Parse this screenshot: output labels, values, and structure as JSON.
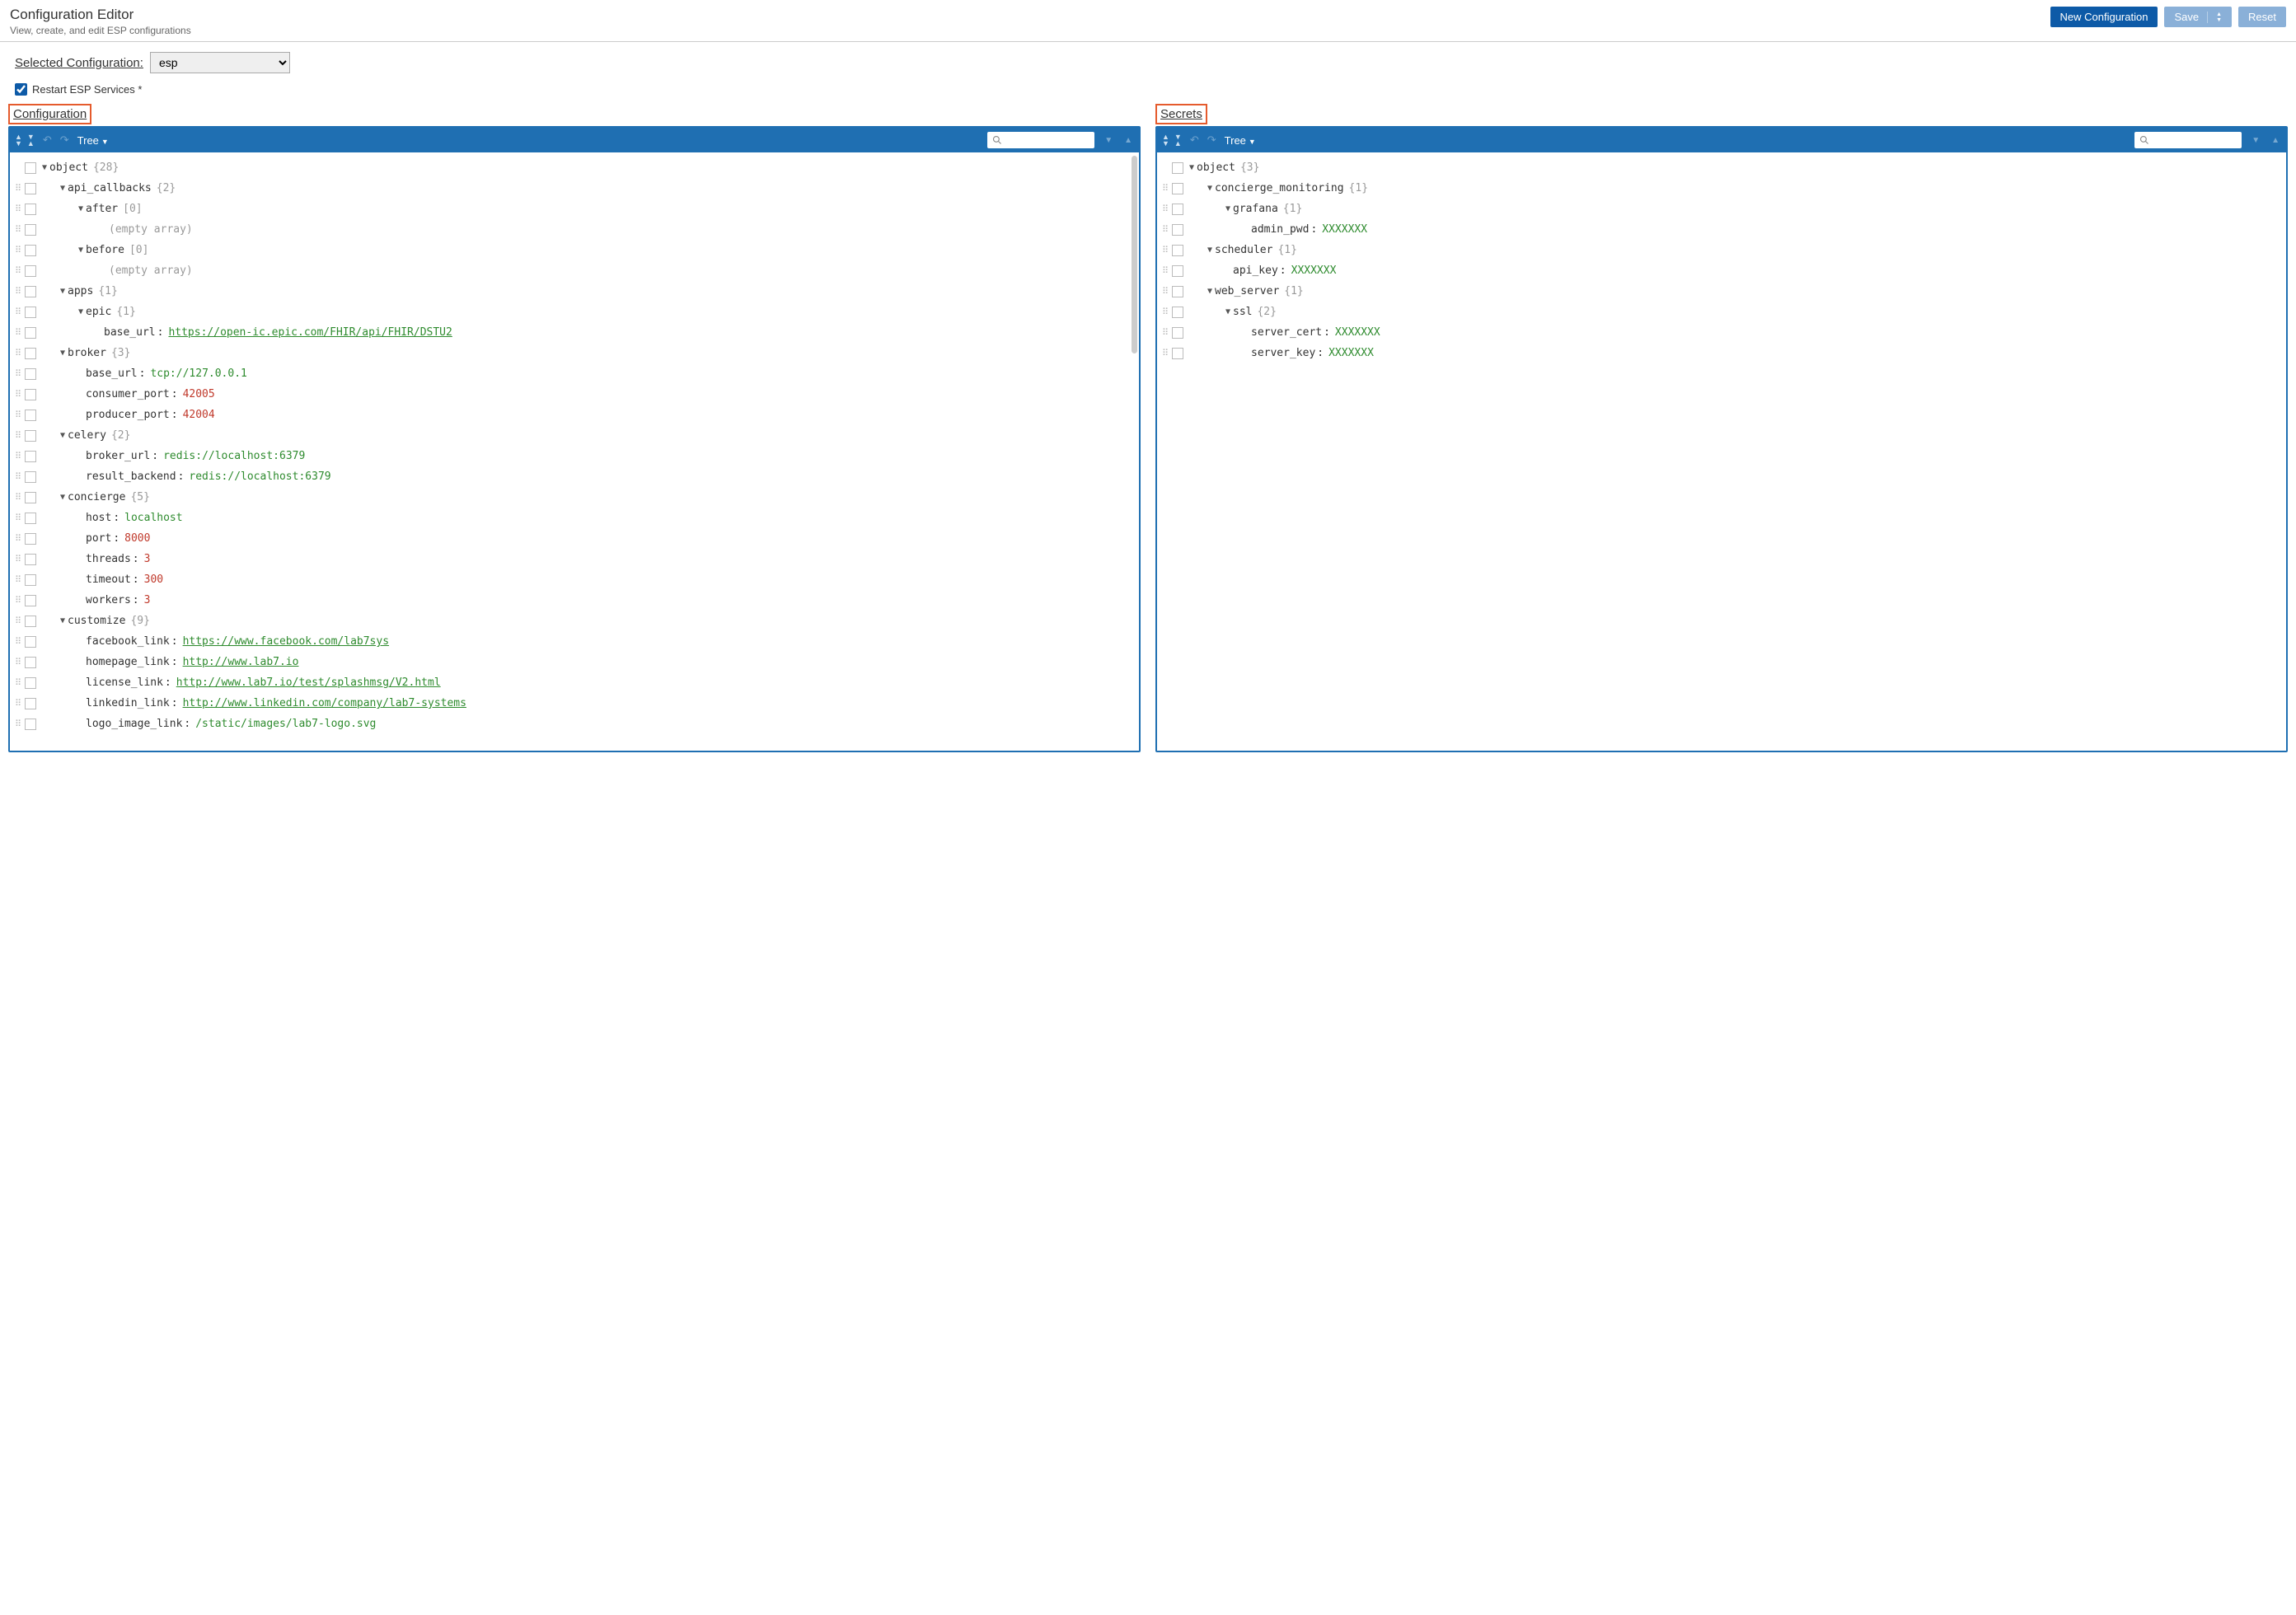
{
  "header": {
    "title": "Configuration Editor",
    "subtitle": "View, create, and edit ESP configurations",
    "buttons": {
      "new": "New Configuration",
      "save": "Save",
      "reset": "Reset"
    }
  },
  "selector": {
    "label": "Selected Configuration:",
    "value": "esp"
  },
  "restart": {
    "label": "Restart ESP Services *",
    "checked": true
  },
  "panels": {
    "config_title": "Configuration",
    "secrets_title": "Secrets"
  },
  "toolbar": {
    "mode": "Tree"
  },
  "config_tree": [
    {
      "indent": 0,
      "tw": "▼",
      "key": "object",
      "meta": "{28}",
      "handle": false
    },
    {
      "indent": 1,
      "tw": "▼",
      "key": "api_callbacks",
      "meta": "{2}"
    },
    {
      "indent": 2,
      "tw": "▼",
      "key": "after",
      "meta": "[0]"
    },
    {
      "indent": 3,
      "tw": "",
      "key": "",
      "literal": "(empty array)",
      "handleOnly": true
    },
    {
      "indent": 2,
      "tw": "▼",
      "key": "before",
      "meta": "[0]"
    },
    {
      "indent": 3,
      "tw": "",
      "key": "",
      "literal": "(empty array)",
      "handleOnly": true
    },
    {
      "indent": 1,
      "tw": "▼",
      "key": "apps",
      "meta": "{1}"
    },
    {
      "indent": 2,
      "tw": "▼",
      "key": "epic",
      "meta": "{1}"
    },
    {
      "indent": 3,
      "tw": "",
      "key": "base_url",
      "vtype": "url",
      "val": "https://open-ic.epic.com/FHIR/api/FHIR/DSTU2"
    },
    {
      "indent": 1,
      "tw": "▼",
      "key": "broker",
      "meta": "{3}"
    },
    {
      "indent": 2,
      "tw": "",
      "key": "base_url",
      "vtype": "str",
      "val": "tcp://127.0.0.1"
    },
    {
      "indent": 2,
      "tw": "",
      "key": "consumer_port",
      "vtype": "num",
      "val": "42005"
    },
    {
      "indent": 2,
      "tw": "",
      "key": "producer_port",
      "vtype": "num",
      "val": "42004"
    },
    {
      "indent": 1,
      "tw": "▼",
      "key": "celery",
      "meta": "{2}"
    },
    {
      "indent": 2,
      "tw": "",
      "key": "broker_url",
      "vtype": "str",
      "val": "redis://localhost:6379"
    },
    {
      "indent": 2,
      "tw": "",
      "key": "result_backend",
      "vtype": "str",
      "val": "redis://localhost:6379"
    },
    {
      "indent": 1,
      "tw": "▼",
      "key": "concierge",
      "meta": "{5}"
    },
    {
      "indent": 2,
      "tw": "",
      "key": "host",
      "vtype": "str",
      "val": "localhost"
    },
    {
      "indent": 2,
      "tw": "",
      "key": "port",
      "vtype": "num",
      "val": "8000"
    },
    {
      "indent": 2,
      "tw": "",
      "key": "threads",
      "vtype": "num",
      "val": "3"
    },
    {
      "indent": 2,
      "tw": "",
      "key": "timeout",
      "vtype": "num",
      "val": "300"
    },
    {
      "indent": 2,
      "tw": "",
      "key": "workers",
      "vtype": "num",
      "val": "3"
    },
    {
      "indent": 1,
      "tw": "▼",
      "key": "customize",
      "meta": "{9}"
    },
    {
      "indent": 2,
      "tw": "",
      "key": "facebook_link",
      "vtype": "url",
      "val": "https://www.facebook.com/lab7sys"
    },
    {
      "indent": 2,
      "tw": "",
      "key": "homepage_link",
      "vtype": "url",
      "val": "http://www.lab7.io"
    },
    {
      "indent": 2,
      "tw": "",
      "key": "license_link",
      "vtype": "url",
      "val": "http://www.lab7.io/test/splashmsg/V2.html"
    },
    {
      "indent": 2,
      "tw": "",
      "key": "linkedin_link",
      "vtype": "url",
      "val": "http://www.linkedin.com/company/lab7-systems"
    },
    {
      "indent": 2,
      "tw": "",
      "key": "logo_image_link",
      "vtype": "str",
      "val": "/static/images/lab7-logo.svg"
    }
  ],
  "secrets_tree": [
    {
      "indent": 0,
      "tw": "▼",
      "key": "object",
      "meta": "{3}",
      "handle": false
    },
    {
      "indent": 1,
      "tw": "▼",
      "key": "concierge_monitoring",
      "meta": "{1}"
    },
    {
      "indent": 2,
      "tw": "▼",
      "key": "grafana",
      "meta": "{1}"
    },
    {
      "indent": 3,
      "tw": "",
      "key": "admin_pwd",
      "vtype": "str",
      "val": "XXXXXXX"
    },
    {
      "indent": 1,
      "tw": "▼",
      "key": "scheduler",
      "meta": "{1}"
    },
    {
      "indent": 2,
      "tw": "",
      "key": "api_key",
      "vtype": "str",
      "val": "XXXXXXX"
    },
    {
      "indent": 1,
      "tw": "▼",
      "key": "web_server",
      "meta": "{1}"
    },
    {
      "indent": 2,
      "tw": "▼",
      "key": "ssl",
      "meta": "{2}"
    },
    {
      "indent": 3,
      "tw": "",
      "key": "server_cert",
      "vtype": "str",
      "val": "XXXXXXX"
    },
    {
      "indent": 3,
      "tw": "",
      "key": "server_key",
      "vtype": "str",
      "val": "XXXXXXX"
    }
  ]
}
